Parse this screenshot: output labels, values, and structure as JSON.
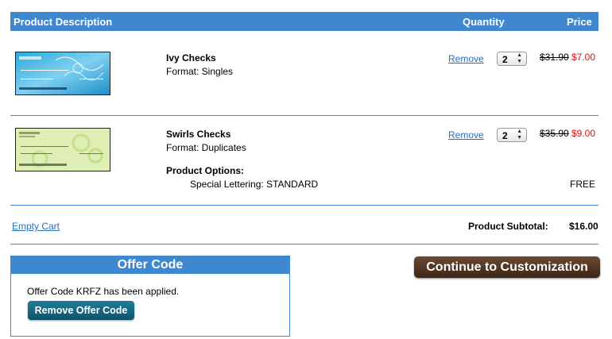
{
  "header": {
    "description": "Product Description",
    "quantity": "Quantity",
    "price": "Price"
  },
  "items": [
    {
      "name": "Ivy Checks",
      "format": "Format: Singles",
      "remove": "Remove",
      "qty": "2",
      "old_price": "$31.90",
      "new_price": "$7.00"
    },
    {
      "name": "Swirls Checks",
      "format": "Format: Duplicates",
      "remove": "Remove",
      "qty": "2",
      "old_price": "$35.90",
      "new_price": "$9.00",
      "options_label": "Product Options:",
      "option_line": "Special Lettering: STANDARD",
      "option_price": "FREE"
    }
  ],
  "cart": {
    "empty_cart": "Empty Cart",
    "subtotal_label": "Product Subtotal:",
    "subtotal_value": "$16.00"
  },
  "offer": {
    "title": "Offer Code",
    "message": "Offer Code KRFZ has been applied.",
    "remove_button": "Remove Offer Code"
  },
  "continue_button": "Continue to Customization",
  "colors": {
    "header_blue": "#3f87cf",
    "link_blue": "#2a6ebb",
    "sale_red": "#d4141c",
    "continue_brown": "#4e3322",
    "offer_button_teal": "#0e5268"
  }
}
